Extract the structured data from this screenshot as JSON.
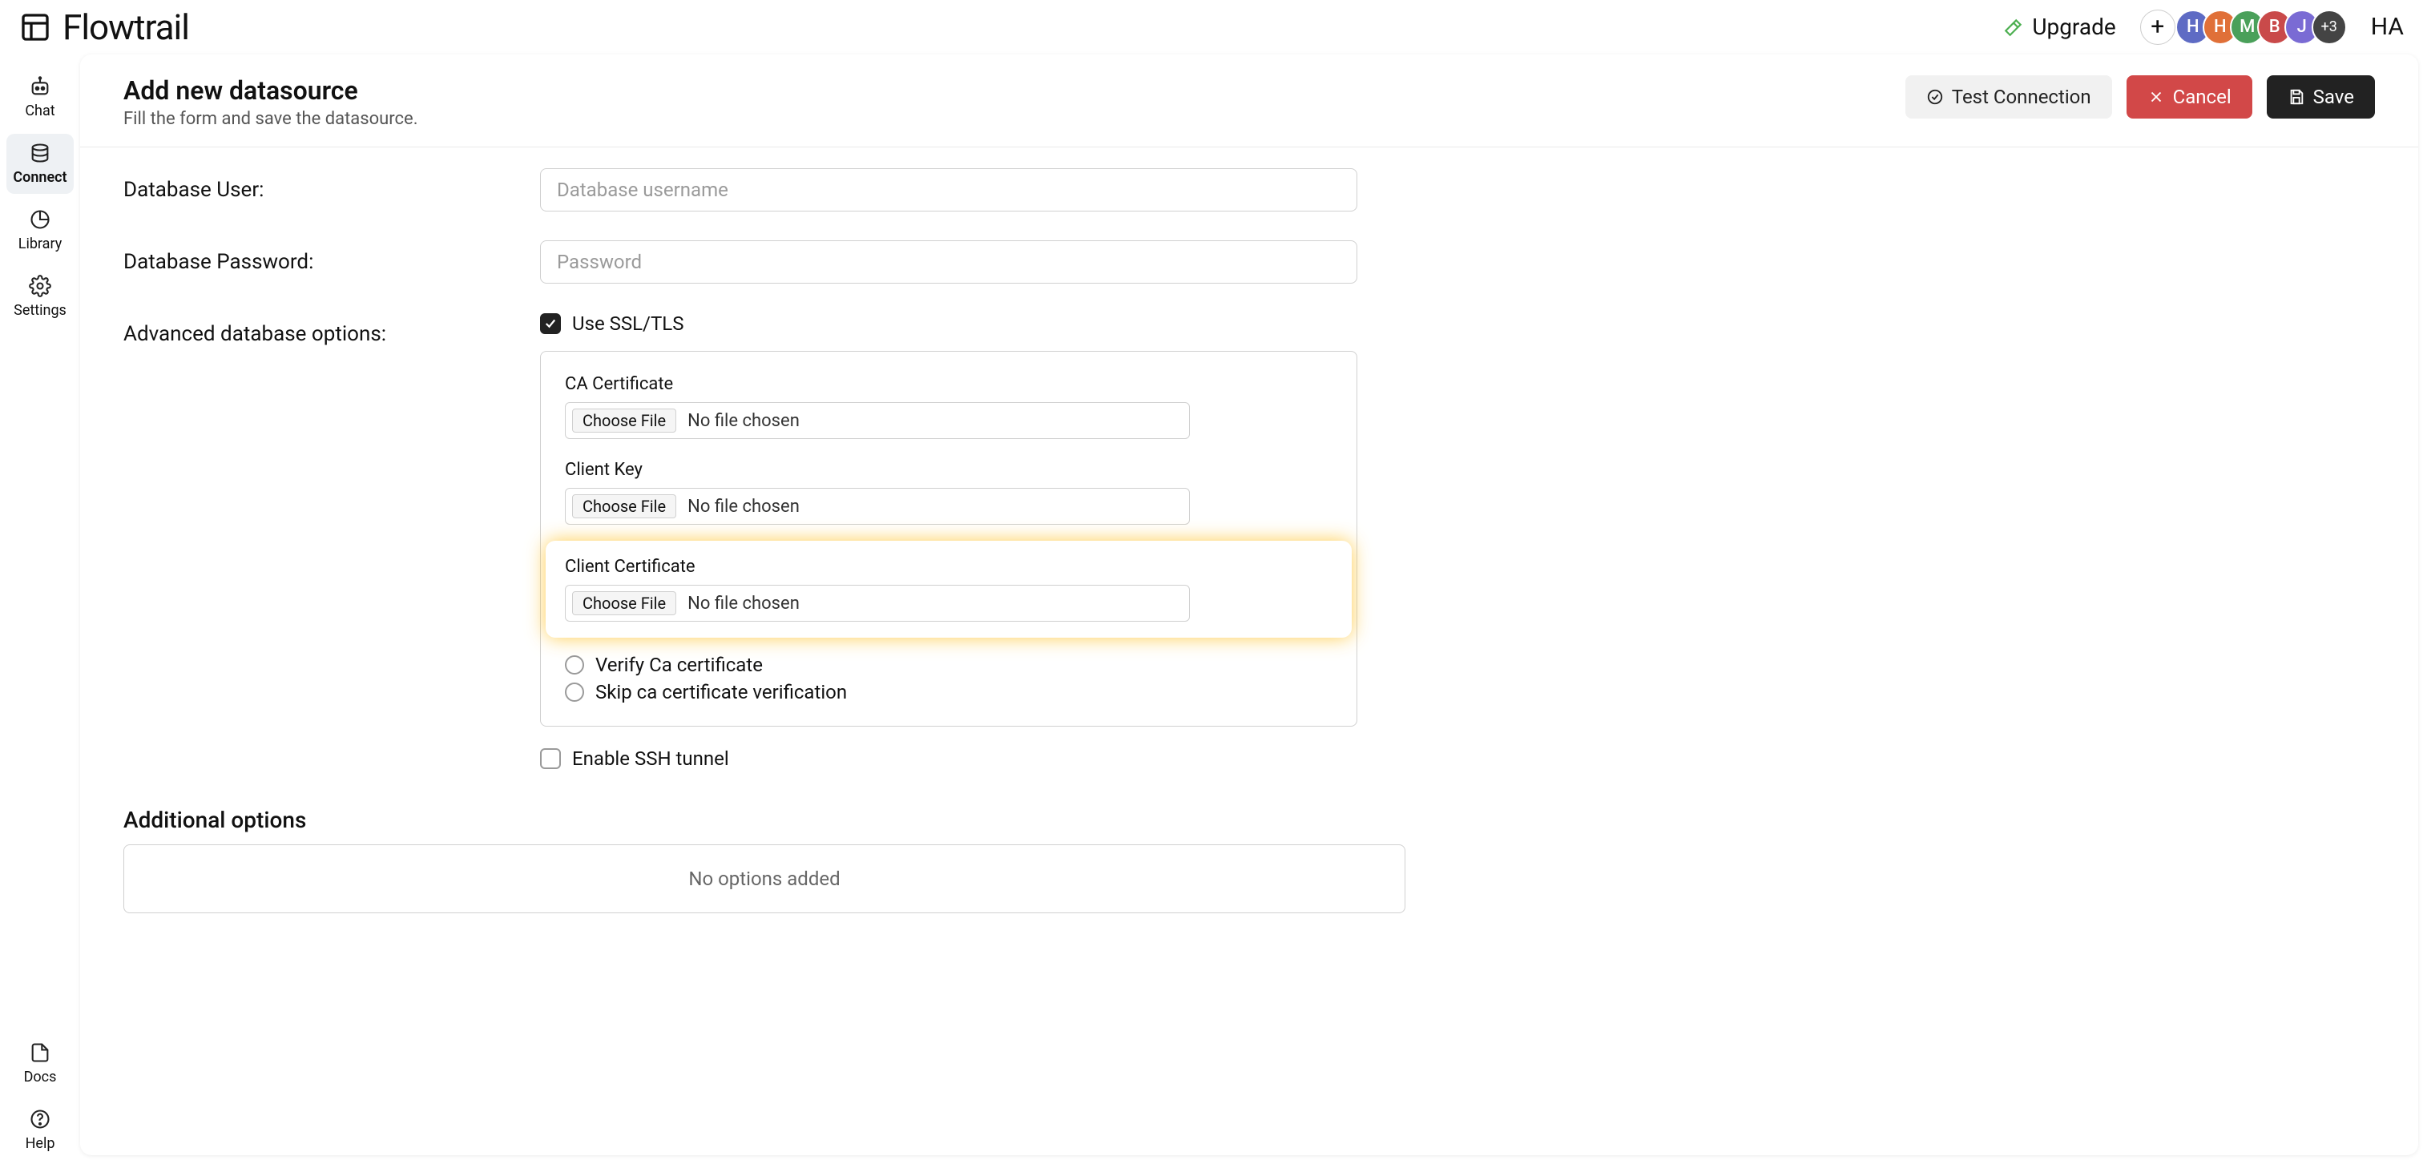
{
  "brand": {
    "name": "Flowtrail"
  },
  "topbar": {
    "upgrade_label": "Upgrade",
    "avatars": [
      {
        "initial": "H",
        "bg": "#5e6bc4"
      },
      {
        "initial": "H",
        "bg": "#e07038"
      },
      {
        "initial": "M",
        "bg": "#4aa05a"
      },
      {
        "initial": "B",
        "bg": "#c94a4a"
      },
      {
        "initial": "J",
        "bg": "#7a6bd4"
      }
    ],
    "avatar_more": "+3",
    "profile_initials": "HA"
  },
  "sidebar": {
    "items": [
      {
        "id": "chat",
        "label": "Chat"
      },
      {
        "id": "connect",
        "label": "Connect"
      },
      {
        "id": "library",
        "label": "Library"
      },
      {
        "id": "settings",
        "label": "Settings"
      }
    ],
    "bottom_items": [
      {
        "id": "docs",
        "label": "Docs"
      },
      {
        "id": "help",
        "label": "Help"
      }
    ],
    "active_id": "connect"
  },
  "page": {
    "title": "Add new datasource",
    "subtitle": "Fill the form and save the datasource."
  },
  "actions": {
    "test_label": "Test Connection",
    "cancel_label": "Cancel",
    "save_label": "Save"
  },
  "form": {
    "db_user_label": "Database User:",
    "db_user_placeholder": "Database username",
    "db_pass_label": "Database Password:",
    "db_pass_placeholder": "Password",
    "adv_label": "Advanced database options:",
    "use_ssl_label": "Use SSL/TLS",
    "use_ssl_checked": true,
    "ssl": {
      "ca_label": "CA Certificate",
      "client_key_label": "Client Key",
      "client_cert_label": "Client Certificate",
      "choose_file_label": "Choose File",
      "no_file_label": "No file chosen",
      "verify_label": "Verify Ca certificate",
      "skip_label": "Skip ca certificate verification"
    },
    "ssh_label": "Enable SSH tunnel",
    "ssh_checked": false,
    "additional_title": "Additional options",
    "additional_empty": "No options added"
  }
}
